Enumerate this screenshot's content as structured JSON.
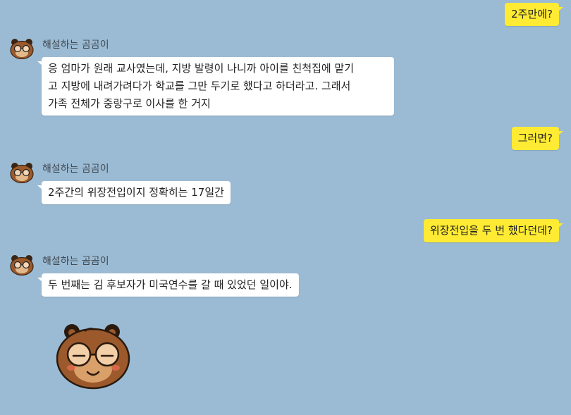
{
  "colors": {
    "background": "#9bbbd4",
    "my_bubble": "#ffeb33",
    "their_bubble": "#ffffff",
    "bear_fur": "#9c5a2c"
  },
  "sender_name": "해설하는 곰곰이",
  "messages": [
    {
      "from": "me",
      "text": "2주만에?"
    },
    {
      "from": "them",
      "sender": "해설하는 곰곰이",
      "lines": [
        "응 엄마가 원래 교사였는데, 지방 발령이 나니까 아이를 친척집에 맡기",
        "고 지방에 내려가려다가 학교를 그만 두기로 했다고 하더라고. 그래서",
        "가족 전체가 중랑구로 이사를 한 거지"
      ]
    },
    {
      "from": "me",
      "text": "그러면?"
    },
    {
      "from": "them",
      "sender": "해설하는 곰곰이",
      "lines": [
        "2주간의 위장전입이지 정확히는 17일간"
      ]
    },
    {
      "from": "me",
      "text": "위장전입을 두 번 했다던데?"
    },
    {
      "from": "them",
      "sender": "해설하는 곰곰이",
      "lines": [
        "두 번째는 김 후보자가 미국연수를 갈 때 있었던 일이야."
      ]
    },
    {
      "from": "them",
      "sticker": "bear-glasses-smile-sticker"
    }
  ]
}
